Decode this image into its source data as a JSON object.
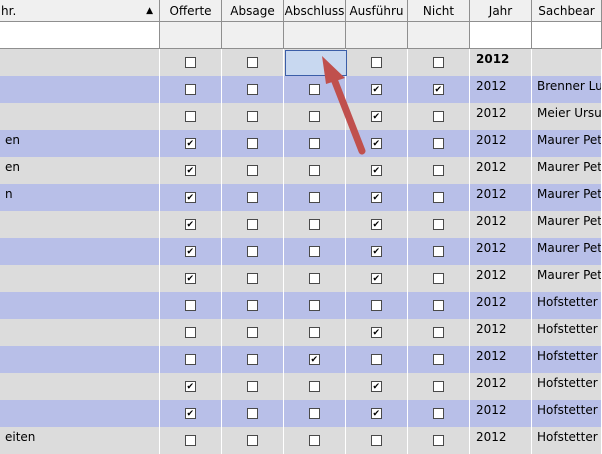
{
  "columns": {
    "bezeichnung": "hr.",
    "offerte": "Offerte",
    "absage": "Absage",
    "abschluss": "Abschluss",
    "ausfuhrung": "Ausführu",
    "nicht": "Nicht",
    "jahr": "Jahr",
    "sachbearbeiter": "Sachbear"
  },
  "rows": [
    {
      "label": "",
      "offerte": false,
      "absage": false,
      "abschluss": true,
      "ausfuhrung": false,
      "nicht": false,
      "jahr": "2012",
      "sachbearbeiter": "",
      "style": "even",
      "bold": true
    },
    {
      "label": "",
      "offerte": false,
      "absage": false,
      "abschluss": false,
      "ausfuhrung": true,
      "nicht": true,
      "jahr": "2012",
      "sachbearbeiter": "Brenner Luk",
      "style": "odd"
    },
    {
      "label": "",
      "offerte": false,
      "absage": false,
      "abschluss": false,
      "ausfuhrung": true,
      "nicht": false,
      "jahr": "2012",
      "sachbearbeiter": "Meier Ursula",
      "style": "even"
    },
    {
      "label": "en",
      "offerte": true,
      "absage": false,
      "abschluss": false,
      "ausfuhrung": true,
      "nicht": false,
      "jahr": "2012",
      "sachbearbeiter": "Maurer Pete",
      "style": "odd"
    },
    {
      "label": "en",
      "offerte": true,
      "absage": false,
      "abschluss": false,
      "ausfuhrung": true,
      "nicht": false,
      "jahr": "2012",
      "sachbearbeiter": "Maurer Pete",
      "style": "even"
    },
    {
      "label": "n",
      "offerte": true,
      "absage": false,
      "abschluss": false,
      "ausfuhrung": true,
      "nicht": false,
      "jahr": "2012",
      "sachbearbeiter": "Maurer Pete",
      "style": "odd"
    },
    {
      "label": "",
      "offerte": true,
      "absage": false,
      "abschluss": false,
      "ausfuhrung": true,
      "nicht": false,
      "jahr": "2012",
      "sachbearbeiter": "Maurer Pete",
      "style": "even"
    },
    {
      "label": "",
      "offerte": true,
      "absage": false,
      "abschluss": false,
      "ausfuhrung": true,
      "nicht": false,
      "jahr": "2012",
      "sachbearbeiter": "Maurer Pete",
      "style": "odd"
    },
    {
      "label": "",
      "offerte": true,
      "absage": false,
      "abschluss": false,
      "ausfuhrung": true,
      "nicht": false,
      "jahr": "2012",
      "sachbearbeiter": "Maurer Pete",
      "style": "even"
    },
    {
      "label": "",
      "offerte": false,
      "absage": false,
      "abschluss": false,
      "ausfuhrung": false,
      "nicht": false,
      "jahr": "2012",
      "sachbearbeiter": "Hofstetter U",
      "style": "odd"
    },
    {
      "label": "",
      "offerte": false,
      "absage": false,
      "abschluss": false,
      "ausfuhrung": true,
      "nicht": false,
      "jahr": "2012",
      "sachbearbeiter": "Hofstetter U",
      "style": "even"
    },
    {
      "label": "",
      "offerte": false,
      "absage": false,
      "abschluss": true,
      "ausfuhrung": false,
      "nicht": false,
      "jahr": "2012",
      "sachbearbeiter": "Hofstetter U",
      "style": "odd"
    },
    {
      "label": "",
      "offerte": true,
      "absage": false,
      "abschluss": false,
      "ausfuhrung": true,
      "nicht": false,
      "jahr": "2012",
      "sachbearbeiter": "Hofstetter U",
      "style": "even"
    },
    {
      "label": "",
      "offerte": true,
      "absage": false,
      "abschluss": false,
      "ausfuhrung": true,
      "nicht": false,
      "jahr": "2012",
      "sachbearbeiter": "Hofstetter U",
      "style": "odd"
    },
    {
      "label": "eiten",
      "offerte": false,
      "absage": false,
      "abschluss": false,
      "ausfuhrung": false,
      "nicht": false,
      "jahr": "2012",
      "sachbearbeiter": "Hofstetter U",
      "style": "even"
    }
  ],
  "annotation": {
    "arrow_color": "#c0504d"
  },
  "colors": {
    "row_odd": "#b8bfe8",
    "row_even": "#dcdcdc",
    "focus": "#c8d8f0"
  },
  "icons": {
    "sort": "sort-up-triangle"
  }
}
